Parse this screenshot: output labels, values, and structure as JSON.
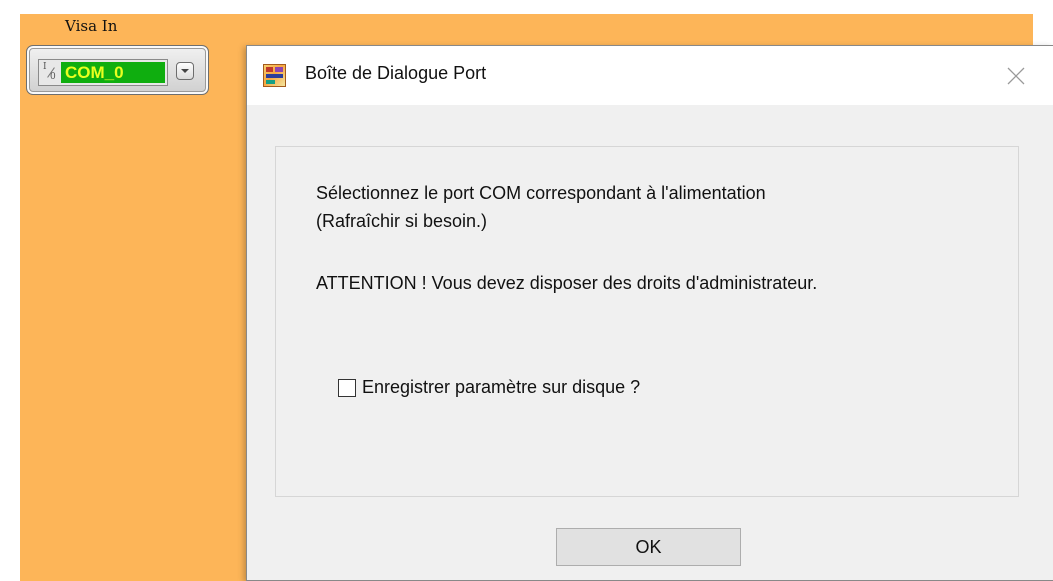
{
  "visa_control": {
    "label": "Visa In",
    "io_top": "I",
    "io_bottom": "0",
    "value": "COM_0",
    "value_background": "#0fae0f",
    "value_color": "#e9ff20",
    "dropdown_icon": "chevron-down-icon"
  },
  "background_color": "#fdb558",
  "dialog": {
    "title": "Boîte de Dialogue Port",
    "app_icon": "labview-app-icon",
    "close_icon": "close-icon",
    "message_line1": "Sélectionnez le port COM correspondant à l'alimentation",
    "message_line2": "(Rafraîchir si besoin.)",
    "warning": "ATTENTION ! Vous devez disposer des droits d'administrateur.",
    "checkbox_label": "Enregistrer paramètre  sur disque ?",
    "checkbox_checked": false,
    "ok_label": "OK"
  }
}
